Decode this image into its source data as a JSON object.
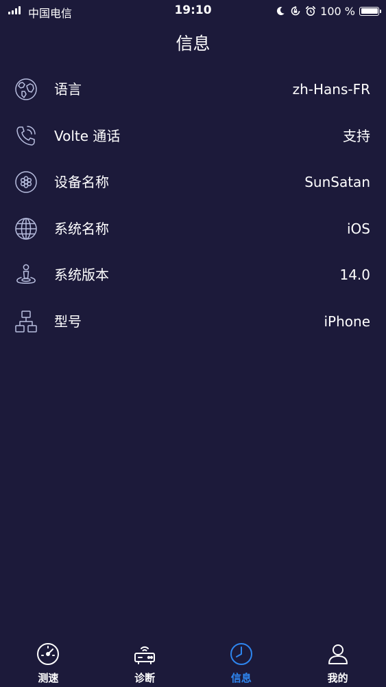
{
  "status_bar": {
    "carrier": "中国电信",
    "time": "19:10",
    "battery": "100 %",
    "icons": [
      "signal-icon",
      "moon-icon",
      "rotation-lock-icon",
      "alarm-icon",
      "battery-icon"
    ]
  },
  "page": {
    "title": "信息"
  },
  "info_rows": [
    {
      "icon": "globe-earth-icon",
      "label": "语言",
      "value": "zh-Hans-FR"
    },
    {
      "icon": "phone-call-icon",
      "label": "Volte 通话",
      "value": "支持"
    },
    {
      "icon": "flower-chip-icon",
      "label": "设备名称",
      "value": "SunSatan"
    },
    {
      "icon": "globe-grid-icon",
      "label": "系统名称",
      "value": "iOS"
    },
    {
      "icon": "location-person-icon",
      "label": "系统版本",
      "value": "14.0"
    },
    {
      "icon": "hierarchy-icon",
      "label": "型号",
      "value": "iPhone"
    }
  ],
  "tab_bar": {
    "tabs": [
      {
        "icon": "speedometer-icon",
        "label": "测速",
        "active": false
      },
      {
        "icon": "router-icon",
        "label": "诊断",
        "active": false
      },
      {
        "icon": "clock-icon",
        "label": "信息",
        "active": true
      },
      {
        "icon": "user-icon",
        "label": "我的",
        "active": false
      }
    ]
  },
  "colors": {
    "background": "#1c1a3a",
    "text": "#ffffff",
    "icon_stroke": "#b9bfe0",
    "active_tab": "#2e86f0"
  }
}
